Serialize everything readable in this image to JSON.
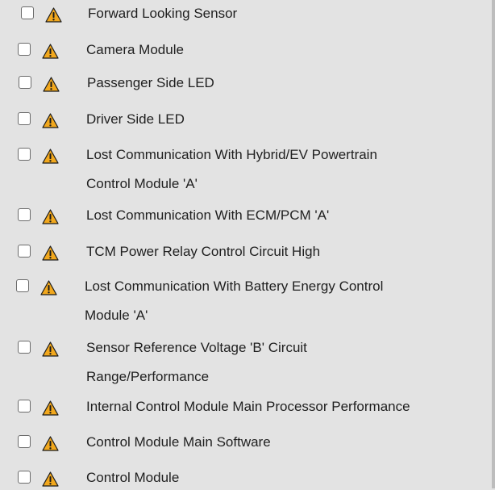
{
  "items": [
    {
      "label_lines": [
        "Forward Looking Sensor"
      ],
      "checked": false,
      "icon": "warning-icon"
    },
    {
      "label_lines": [
        "Camera Module"
      ],
      "checked": false,
      "icon": "warning-icon"
    },
    {
      "label_lines": [
        "Passenger Side LED"
      ],
      "checked": false,
      "icon": "warning-icon"
    },
    {
      "label_lines": [
        "Driver Side LED"
      ],
      "checked": false,
      "icon": "warning-icon"
    },
    {
      "label_lines": [
        "Lost Communication With Hybrid/EV Powertrain",
        "Control Module 'A'"
      ],
      "checked": false,
      "icon": "warning-icon"
    },
    {
      "label_lines": [
        "Lost Communication With ECM/PCM 'A'"
      ],
      "checked": false,
      "icon": "warning-icon"
    },
    {
      "label_lines": [
        "TCM Power Relay Control Circuit High"
      ],
      "checked": false,
      "icon": "warning-icon"
    },
    {
      "label_lines": [
        "Lost Communication With Battery Energy Control",
        "Module 'A'"
      ],
      "checked": false,
      "icon": "warning-icon"
    },
    {
      "label_lines": [
        "Sensor Reference Voltage 'B' Circuit",
        "Range/Performance"
      ],
      "checked": false,
      "icon": "warning-icon"
    },
    {
      "label_lines": [
        "Internal Control Module Main Processor Performance"
      ],
      "checked": false,
      "icon": "warning-icon"
    },
    {
      "label_lines": [
        "Control Module Main Software"
      ],
      "checked": false,
      "icon": "warning-icon"
    },
    {
      "label_lines": [
        "Control Module"
      ],
      "checked": false,
      "icon": "warning-icon"
    }
  ],
  "colors": {
    "warning_fill": "#f2a81d",
    "warning_mark": "#1a1a1a",
    "background": "#e3e3e3"
  }
}
